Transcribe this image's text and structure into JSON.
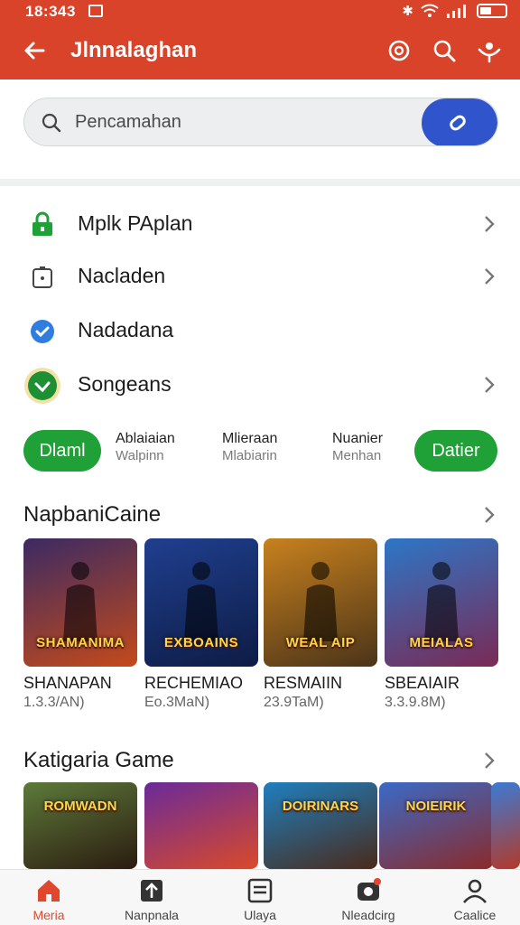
{
  "status": {
    "time": "18:343"
  },
  "appbar": {
    "title": "Jlnnalaghan"
  },
  "search": {
    "placeholder": "Pencamahan"
  },
  "menu": [
    {
      "label": "Mplk PAplan",
      "icon": "lock-icon"
    },
    {
      "label": "Nacladen",
      "icon": "timer-icon"
    },
    {
      "label": "Nadadana",
      "icon": "verified-icon"
    },
    {
      "label": "Songeans",
      "icon": "check-circle-icon"
    }
  ],
  "chips": {
    "left_pill": "Dlaml",
    "stats": [
      {
        "a": "Ablaiaian",
        "b": "Walpinn"
      },
      {
        "a": "Mlieraan",
        "b": "Mlabiarin"
      },
      {
        "a": "Nuanier",
        "b": "Menhan"
      }
    ],
    "right_pill": "Datier"
  },
  "section1": {
    "title": "NapbaniCaine",
    "games": [
      {
        "name": "SHANAPAN",
        "size": "1.3.3/AN)",
        "art": "SHAMANIMA",
        "c1": "#3b2a63",
        "c2": "#c44a1b"
      },
      {
        "name": "RECHEMIAO",
        "size": "Eo.3MaN)",
        "art": "EXBOAINS",
        "c1": "#1f3f8f",
        "c2": "#0e1c45"
      },
      {
        "name": "RESMAIIN",
        "size": "23.9TaM)",
        "art": "WEAL AIP",
        "c1": "#c7811e",
        "c2": "#4b3419"
      },
      {
        "name": "SBEAIAIR",
        "size": "3.3.9.8M)",
        "art": "MEIALAS",
        "c1": "#2d76c7",
        "c2": "#7a2a55"
      }
    ]
  },
  "section2": {
    "title": "Katigaria Game",
    "games": [
      {
        "art": "ROMWADN",
        "c1": "#5d7a3a",
        "c2": "#2b1b10"
      },
      {
        "art": "",
        "c1": "#6a2a9a",
        "c2": "#d94a2a"
      },
      {
        "art": "DOIRINARS",
        "c1": "#1e7fbf",
        "c2": "#4a2a1a"
      },
      {
        "art": "NOIEIRIK",
        "c1": "#3a6ac7",
        "c2": "#8a2a2a"
      }
    ]
  },
  "bottomnav": [
    {
      "label": "Meria",
      "icon": "home-icon"
    },
    {
      "label": "Nanpnala",
      "icon": "upload-icon"
    },
    {
      "label": "Ulaya",
      "icon": "library-icon"
    },
    {
      "label": "Nleadcirg",
      "icon": "camera-icon"
    },
    {
      "label": "Caalice",
      "icon": "profile-icon"
    }
  ],
  "colors": {
    "brand": "#d8432a",
    "accent": "#2f54cc",
    "green": "#1fa137"
  }
}
